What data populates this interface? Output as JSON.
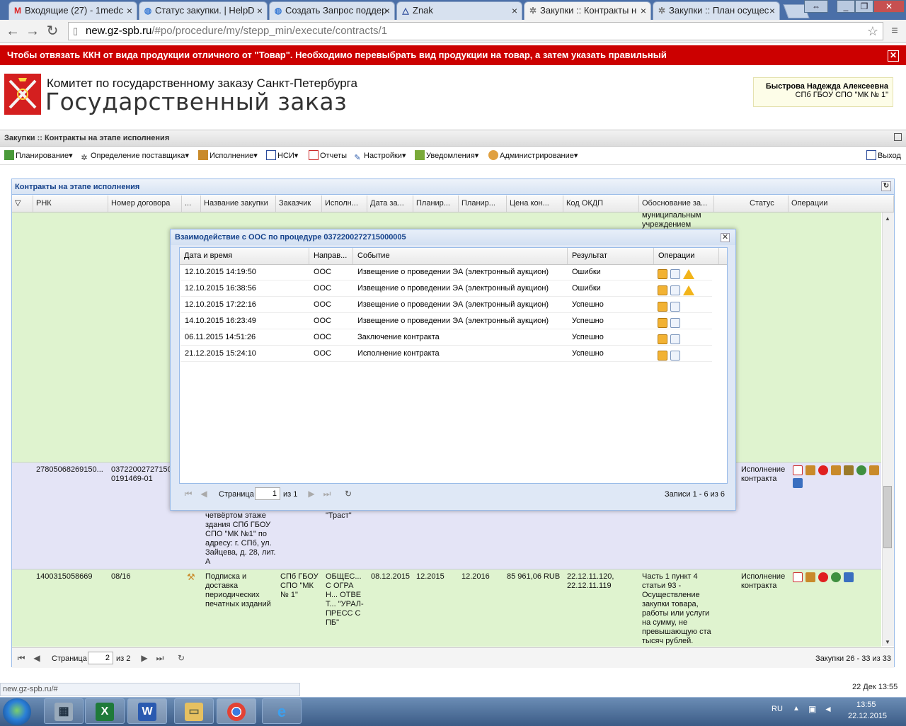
{
  "browser": {
    "tabs": [
      {
        "label": "Входящие (27) - 1medc",
        "icon": "gmail-icon"
      },
      {
        "label": "Статус закупки. | HelpD",
        "icon": "globe-icon"
      },
      {
        "label": "Создать Запрос поддер",
        "icon": "globe-icon"
      },
      {
        "label": "Znak",
        "icon": "znak-icon"
      },
      {
        "label": "Закупки :: Контракты н",
        "icon": "gear-icon"
      },
      {
        "label": "Закупки :: План осущес",
        "icon": "gear-icon"
      }
    ],
    "url_domain": "new.gz-spb.ru",
    "url_path": "/#po/procedure/my/stepp_min/execute/contracts/1"
  },
  "alert": {
    "text": "Чтобы отвязать ККН от вида продукции отличного от \"Товар\". Необходимо перевыбрать вид продукции на товар, а затем указать правильный"
  },
  "header": {
    "org_line1": "Комитет по государственному заказу Санкт-Петербурга",
    "org_line2": "Государственный заказ",
    "user_name": "Быстрова Надежда Алексеевна",
    "user_org": "СПб ГБОУ СПО \"МК № 1\""
  },
  "panel_title": "Закупки :: Контракты на этапе исполнения",
  "menu": [
    {
      "label": "Планирование",
      "dropdown": true
    },
    {
      "label": "Определение поставщика",
      "dropdown": true
    },
    {
      "label": "Исполнение",
      "dropdown": true
    },
    {
      "label": "НСИ",
      "dropdown": true
    },
    {
      "label": "Отчеты",
      "dropdown": false
    },
    {
      "label": "Настройки",
      "dropdown": true
    },
    {
      "label": "Уведомления",
      "dropdown": true
    },
    {
      "label": "Администрирование",
      "dropdown": true
    }
  ],
  "logout_label": "Выход",
  "grid": {
    "title": "Контракты на этапе исполнения",
    "columns": [
      "РНК",
      "Номер договора",
      "...",
      "Название закупки",
      "Заказчик",
      "Исполн...",
      "Дата за...",
      "Планир...",
      "Планир...",
      "Цена кон...",
      "Код ОКДП",
      "Обоснование за...",
      "Статус",
      "Операции"
    ],
    "row0_fragment": "муниципальным учреждением",
    "row1": {
      "rnk": "27805068269150...",
      "contract_no": "03722002727150 0191469-01",
      "name_fragment": "четвёртом этаже здания СПб ГБОУ СПО \"МК №1\" по адресу: г. СПб, ул. Зайцева, д. 28, лит. А",
      "contractor_fragment": "\"Траст\"",
      "status": "Исполнение контракта"
    },
    "row2": {
      "rnk": "1400315058669",
      "contract_no": "08/16",
      "name": "Подписка и доставка периодических печатных изданий",
      "customer": "СПб ГБОУ СПО \"МК № 1\"",
      "contractor": "ОБЩЕС... С ОГРАН... ОТВЕТ... \"УРАЛ-ПРЕСС СПБ\"",
      "date": "08.12.2015",
      "plan1": "12.2015",
      "plan2": "12.2016",
      "price": "85 961,06 RUB",
      "okdp": "22.12.11.120, 22.12.11.119",
      "basis": "Часть 1 пункт 4 статьи 93 - Осуществление закупки товара, работы или услуги на сумму, не превышающую ста тысяч рублей.",
      "status": "Исполнение контракта"
    },
    "pager": {
      "page_label": "Страница",
      "page": "2",
      "of": "из 2",
      "records": "Закупки 26 - 33 из 33"
    }
  },
  "modal": {
    "title": "Взаимодействие с ООС по процедуре 0372200272715000005",
    "columns": [
      "Дата и время",
      "Направ...",
      "Событие",
      "Результат",
      "Операции"
    ],
    "rows": [
      {
        "datetime": "12.10.2015 14:19:50",
        "direction": "ООС",
        "event": "Извещение о проведении ЭА (электронный аукцион)",
        "result": "Ошибки",
        "warn": true
      },
      {
        "datetime": "12.10.2015 16:38:56",
        "direction": "ООС",
        "event": "Извещение о проведении ЭА (электронный аукцион)",
        "result": "Ошибки",
        "warn": true
      },
      {
        "datetime": "12.10.2015 17:22:16",
        "direction": "ООС",
        "event": "Извещение о проведении ЭА (электронный аукцион)",
        "result": "Успешно",
        "warn": false
      },
      {
        "datetime": "14.10.2015 16:23:49",
        "direction": "ООС",
        "event": "Извещение о проведении ЭА (электронный аукцион)",
        "result": "Успешно",
        "warn": false
      },
      {
        "datetime": "06.11.2015 14:51:26",
        "direction": "ООС",
        "event": "Заключение контракта",
        "result": "Успешно",
        "warn": false
      },
      {
        "datetime": "21.12.2015 15:24:10",
        "direction": "ООС",
        "event": "Исполнение контракта",
        "result": "Успешно",
        "warn": false
      }
    ],
    "pager": {
      "page_label": "Страница",
      "page": "1",
      "of": "из 1",
      "records": "Записи 1 - 6 из 6"
    }
  },
  "statusbar": {
    "url": "new.gz-spb.ru/#",
    "datetime": "22 Дек 13:55"
  },
  "taskbar": {
    "lang": "RU",
    "time": "13:55",
    "date": "22.12.2015",
    "apps": [
      "calculator-icon",
      "excel-icon",
      "word-icon",
      "explorer-icon",
      "chrome-icon",
      "ie-icon"
    ]
  },
  "colors": {
    "alert_bg": "#cc0000",
    "row_green": "#dff3cf",
    "row_lavender": "#e4e4f6",
    "accent_blue": "#15428b"
  }
}
